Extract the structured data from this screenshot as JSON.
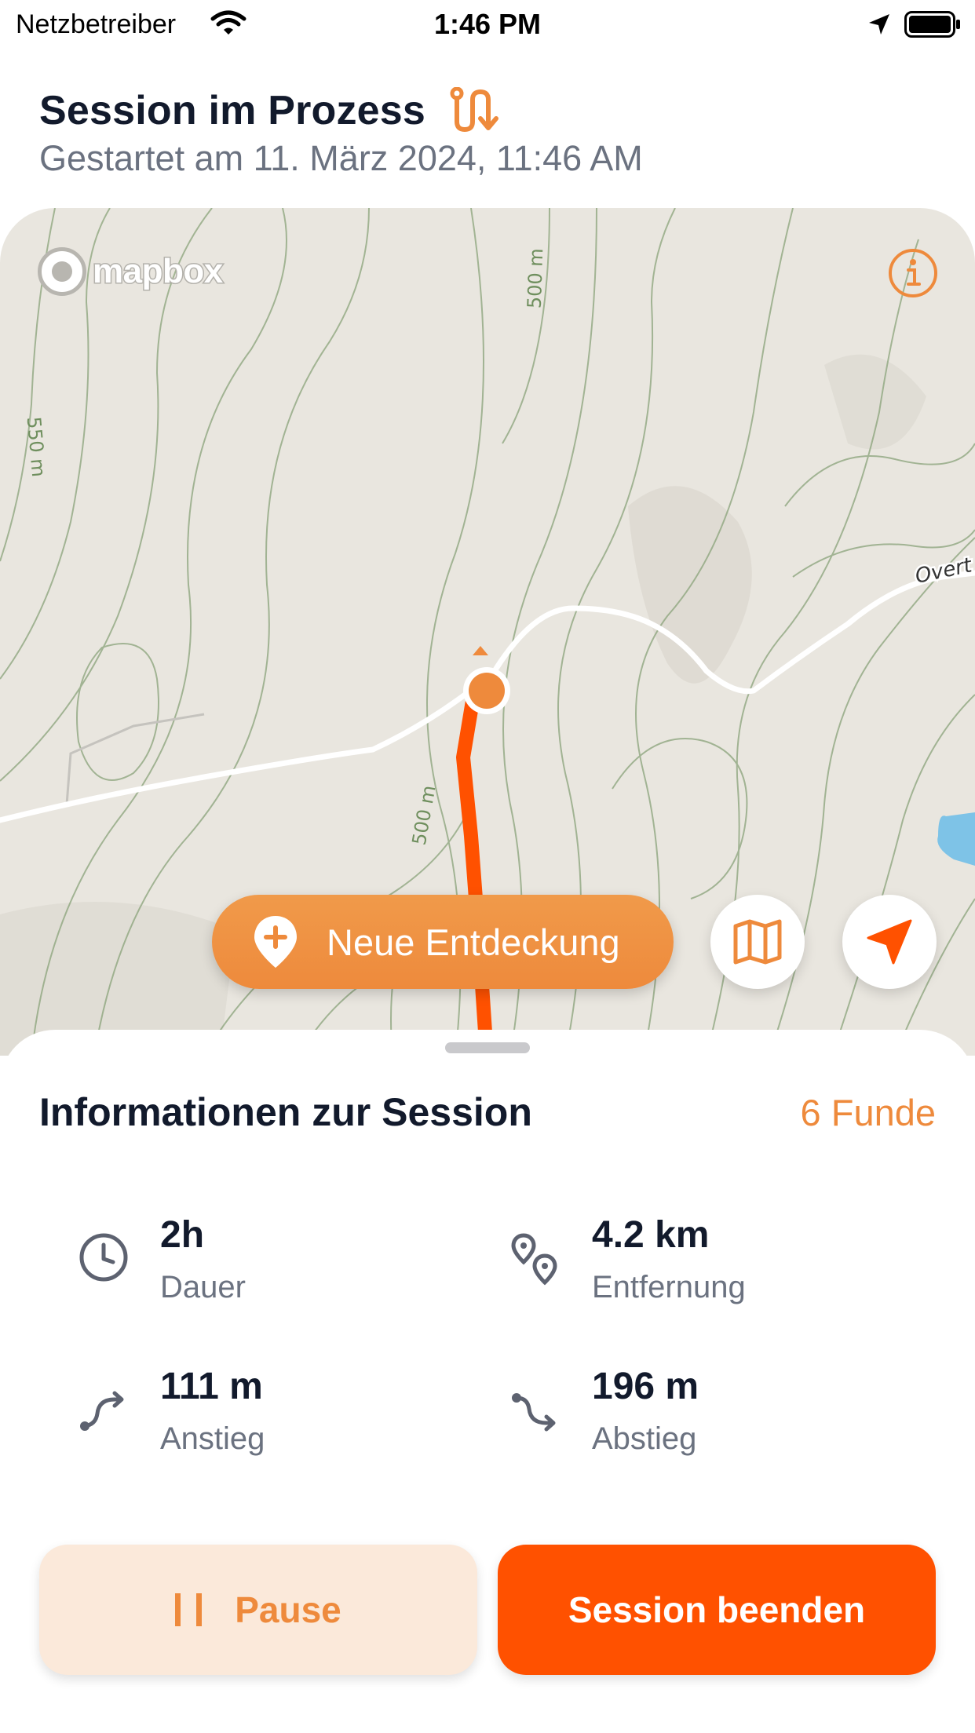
{
  "status_bar": {
    "carrier": "Netzbetreiber",
    "time": "1:46 PM",
    "icons": [
      "wifi-icon",
      "location-arrow-icon",
      "battery-icon"
    ]
  },
  "header": {
    "title": "Session im Prozess",
    "title_icon": "route-icon",
    "subtitle": "Gestartet am 11. März 2024, 11:46 AM"
  },
  "map": {
    "attribution": "mapbox",
    "contour_labels": [
      "500 m",
      "550 m",
      "500 m"
    ],
    "road_label": "Overt",
    "icons": [
      "mapbox-logo-icon",
      "info-icon",
      "user-location-dot"
    ]
  },
  "actions": {
    "discover_label": "Neue Entdeckung",
    "discover_icon": "add-pin-icon",
    "map_layers_icon": "map-icon",
    "recenter_icon": "location-arrow-icon"
  },
  "session_info": {
    "title": "Informationen zur Session",
    "finds": "6 Funde",
    "stats": [
      {
        "icon": "clock-icon",
        "value": "2h",
        "label": "Dauer"
      },
      {
        "icon": "distance-pins-icon",
        "value": "4.2 km",
        "label": "Entfernung"
      },
      {
        "icon": "ascent-icon",
        "value": "111 m",
        "label": "Anstieg"
      },
      {
        "icon": "descent-icon",
        "value": "196 m",
        "label": "Abstieg"
      }
    ]
  },
  "buttons": {
    "pause_label": "Pause",
    "end_label": "Session beenden"
  },
  "colors": {
    "accent": "#EE8A3C",
    "primary": "#FF5100",
    "route": "#FF5100",
    "map_background": "#E9E6DF",
    "contour": "#8AA37A",
    "pause_background": "#FBE9DA",
    "text_dark": "#121A2C",
    "text_secondary": "#6B7280"
  }
}
